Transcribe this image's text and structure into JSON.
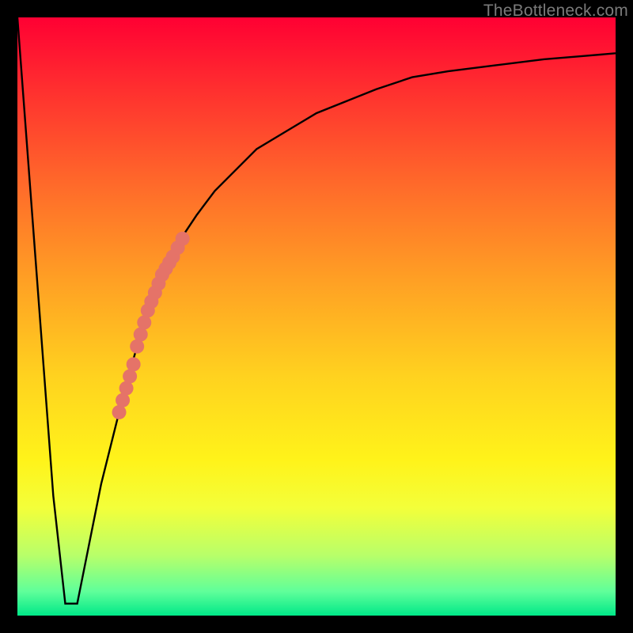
{
  "watermark": "TheBottleneck.com",
  "colors": {
    "background": "#000000",
    "curve": "#000000",
    "marker": "#e57368",
    "gradient_top": "#ff0033",
    "gradient_bottom": "#00e888"
  },
  "chart_data": {
    "type": "line",
    "title": "",
    "xlabel": "",
    "ylabel": "",
    "xlim": [
      0,
      100
    ],
    "ylim": [
      0,
      100
    ],
    "grid": false,
    "legend": false,
    "series": [
      {
        "name": "bottleneck-curve",
        "x": [
          0,
          3,
          6,
          8,
          10,
          12,
          14,
          16,
          18,
          20,
          22,
          24,
          26,
          28,
          30,
          33,
          36,
          40,
          45,
          50,
          55,
          60,
          66,
          72,
          80,
          88,
          94,
          100
        ],
        "y": [
          100,
          60,
          20,
          2,
          2,
          12,
          22,
          30,
          38,
          45,
          51,
          56,
          60,
          64,
          67,
          71,
          74,
          78,
          81,
          84,
          86,
          88,
          90,
          91,
          92,
          93,
          93.5,
          94
        ]
      }
    ],
    "markers": [
      {
        "name": "highlighted-segment",
        "series": "bottleneck-curve",
        "points": [
          {
            "x": 17.0,
            "y": 34
          },
          {
            "x": 17.6,
            "y": 36
          },
          {
            "x": 18.2,
            "y": 38
          },
          {
            "x": 18.8,
            "y": 40
          },
          {
            "x": 19.4,
            "y": 42
          },
          {
            "x": 20.0,
            "y": 45
          },
          {
            "x": 20.6,
            "y": 47
          },
          {
            "x": 21.2,
            "y": 49
          },
          {
            "x": 21.8,
            "y": 51
          },
          {
            "x": 22.4,
            "y": 52.5
          },
          {
            "x": 23.0,
            "y": 54
          },
          {
            "x": 23.6,
            "y": 55.5
          },
          {
            "x": 24.2,
            "y": 57
          },
          {
            "x": 24.8,
            "y": 58
          },
          {
            "x": 25.4,
            "y": 59
          },
          {
            "x": 26.0,
            "y": 60
          },
          {
            "x": 26.8,
            "y": 61.5
          },
          {
            "x": 27.6,
            "y": 63
          }
        ]
      }
    ]
  }
}
